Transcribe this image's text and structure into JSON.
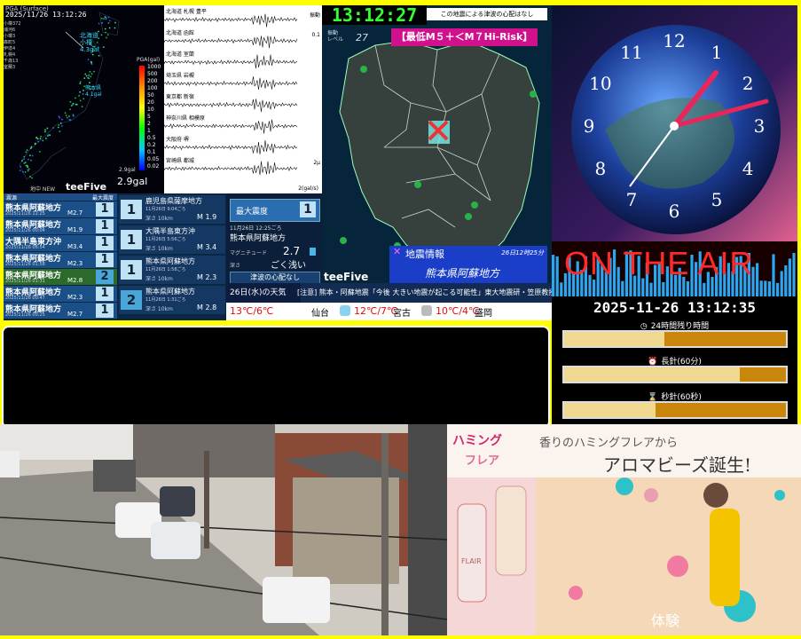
{
  "pga_panel": {
    "header": "PGA (Surface)",
    "datetime": "2025/11/26 13:12:26",
    "station_lines": [
      "小樽372",
      "浦河6",
      "小樽3",
      "森町5",
      "伊達4",
      "札幌4",
      "千歳13",
      "室蘭3"
    ],
    "scale_title": "PGA(gal)",
    "scale_ticks": [
      "1000",
      "500",
      "200",
      "100",
      "50",
      "20",
      "10",
      "5",
      "2",
      "1",
      "0.5",
      "0.2",
      "0.1",
      "0.05",
      "0.02"
    ],
    "max_label": "2.9gal",
    "max_value": "2.9gal",
    "callout_north": "北海道\n小樽\n4.3gal",
    "callout_kyushu": "熊本県\n4.1gal",
    "brand_small": "地中 NEW",
    "brand": "teeFive"
  },
  "waveform_panel": {
    "stations": [
      "北海道 札幌 豊平",
      "北海道 函館",
      "北海道 室蘭",
      "埼玉県 岩槻",
      "東京都 新宿",
      "神奈川県 相模原",
      "大阪府 堺",
      "宮崎県 都城"
    ],
    "right_labels": [
      "振動",
      "0.1",
      "",
      "",
      "",
      "",
      "",
      "2μ"
    ],
    "footer": "2(gal/s)"
  },
  "quake_list": {
    "header_col1": "震源",
    "header_col2": "最大震度",
    "items": [
      {
        "region": "熊本県阿蘇地方",
        "time": "2025/11/26 12:25",
        "mag": "M2.7",
        "shindo": "1",
        "highlight": false
      },
      {
        "region": "熊本県阿蘇地方",
        "time": "2025/11/26 00:04",
        "mag": "M1.9",
        "shindo": "1",
        "highlight": false
      },
      {
        "region": "大隅半島東方沖",
        "time": "2025/11/26 06:54",
        "mag": "M3.4",
        "shindo": "1",
        "highlight": false
      },
      {
        "region": "熊本県阿蘇地方",
        "time": "2025/11/26 01:58",
        "mag": "M2.3",
        "shindo": "1",
        "highlight": false
      },
      {
        "region": "熊本県阿蘇地方",
        "time": "2025/11/26 01:31",
        "mag": "M2.8",
        "shindo": "2",
        "highlight": true
      },
      {
        "region": "熊本県阿蘇地方",
        "time": "2025/11/26 00:47",
        "mag": "M2.3",
        "shindo": "1",
        "highlight": false
      },
      {
        "region": "熊本県阿蘇地方",
        "time": "2025/11/26 00:25",
        "mag": "M2.7",
        "shindo": "1",
        "highlight": false
      }
    ],
    "cards": [
      {
        "shindo": "1",
        "region": "鹿児島県薩摩地方",
        "time": "11月26日 9:04ごろ",
        "depth": "深さ 10km",
        "mag": "M 1.9"
      },
      {
        "shindo": "1",
        "region": "大隅半島東方沖",
        "time": "11月26日 5:56ごろ",
        "depth": "深さ 10km",
        "mag": "M 3.4"
      },
      {
        "shindo": "1",
        "region": "熊本県阿蘇地方",
        "time": "11月26日 1:58ごろ",
        "depth": "深さ 10km",
        "mag": "M 2.3"
      },
      {
        "shindo": "2",
        "region": "熊本県阿蘇地方",
        "time": "11月26日 1:31ごろ",
        "depth": "深さ 10km",
        "mag": "M 2.8"
      }
    ]
  },
  "info_panel": {
    "max_shindo_label": "最大震度",
    "max_shindo_value": "1",
    "time": "11月26日 12:25ごろ",
    "region": "熊本県阿蘇地方",
    "mag_label": "マグニチュード",
    "mag_value": "2.7",
    "depth_label": "深さ",
    "depth_value": "ごく浅い",
    "tsunami": "津波の心配なし"
  },
  "map_panel": {
    "clock": "13:12:27",
    "tsunami_note": "この地震による津波の心配はなし",
    "shindo_level_label": "振動\nレベル",
    "shindo_level_value": "27",
    "risk_banner": "【最低M５＋＜M７Hi-Risk】",
    "info_title": "地震情報",
    "info_time": "26日12時25分",
    "info_region": "熊本県阿蘇地方",
    "brand": "teeFive"
  },
  "onair": {
    "text": "ON THE AIR"
  },
  "weather": {
    "date": "26日(水)の天気",
    "ticker": "[注意] 熊本・阿蘇地震「今後 大きい地震が起こる可能性」東大地震研・笠原教授",
    "items": [
      {
        "city": "",
        "temps": "13℃/6℃",
        "icon": "sun-cloud-icon"
      },
      {
        "city": "仙台",
        "temps": "12℃/7℃",
        "icon": "sun-cloud-icon"
      },
      {
        "city": "宮古",
        "temps": "10℃/4℃",
        "icon": "cloud-icon"
      },
      {
        "city": "盛岡",
        "temps": "",
        "icon": ""
      }
    ]
  },
  "timers": {
    "datetime": "2025-11-26 13:12:35",
    "bars": [
      {
        "label": "24時間残り時間",
        "icon": "clock-icon",
        "fraction": 0.45
      },
      {
        "label": "長針(60分)",
        "icon": "alarm-icon",
        "fraction": 0.79
      },
      {
        "label": "秒針(60秒)",
        "icon": "hourglass-icon",
        "fraction": 0.41
      }
    ]
  },
  "clock_panel": {
    "hour_numbers": [
      "12",
      "1",
      "2",
      "3",
      "4",
      "5",
      "6",
      "7",
      "8",
      "9",
      "10",
      "11"
    ]
  },
  "camera": {},
  "ad": {
    "brand_line1": "ハミング",
    "brand_line2": "フレア",
    "tagline": "香りのハミングフレアから",
    "headline": "アロマビーズ誕生!",
    "product_logo": "FLAIR",
    "footer": "体験"
  }
}
